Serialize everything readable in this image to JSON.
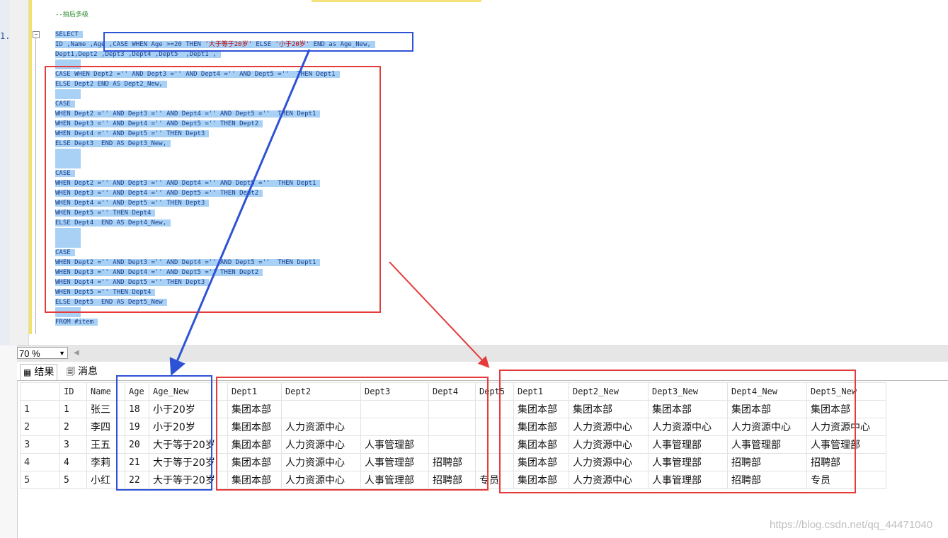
{
  "editor": {
    "line_number": "1.",
    "comment": "--拍后多级",
    "code_lines": [
      "SELECT",
      "ID ,Name ,Age ,CASE WHEN Age >=20 THEN '大于等于20岁' ELSE '小于20岁' END as Age_New,",
      "Dept1,Dept2 ,Dept3 ,Dept4 ,Dept5  ,Dept1 ,",
      "",
      "CASE WHEN Dept2 ='' AND Dept3 ='' AND Dept4 ='' AND Dept5 =''  THEN Dept1",
      "ELSE Dept2 END AS Dept2_New,",
      "",
      "CASE",
      "WHEN Dept2 ='' AND Dept3 ='' AND Dept4 ='' AND Dept5 =''  THEN Dept1",
      "WHEN Dept3 ='' AND Dept4 ='' AND Dept5 ='' THEN Dept2",
      "WHEN Dept4 ='' AND Dept5 ='' THEN Dept3",
      "ELSE Dept3  END AS Dept3_New,",
      "",
      "",
      "CASE",
      "WHEN Dept2 ='' AND Dept3 ='' AND Dept4 ='' AND Dept5 =''  THEN Dept1",
      "WHEN Dept3 ='' AND Dept4 ='' AND Dept5 ='' THEN Dept2",
      "WHEN Dept4 ='' AND Dept5 ='' THEN Dept3",
      "WHEN Dept5 ='' THEN Dept4",
      "ELSE Dept4  END AS Dept4_New,",
      "",
      "",
      "CASE",
      "WHEN Dept2 ='' AND Dept3 ='' AND Dept4 ='' AND Dept5 =''  THEN Dept1",
      "WHEN Dept3 ='' AND Dept4 ='' AND Dept5 ='' THEN Dept2",
      "WHEN Dept4 ='' AND Dept5 ='' THEN Dept3",
      "WHEN Dept5 ='' THEN Dept4",
      "ELSE Dept5  END AS Dept5_New",
      "",
      "FROM #item"
    ]
  },
  "zoom": {
    "value": "70 %"
  },
  "tabs": {
    "results": "结果",
    "messages": "消息"
  },
  "results": {
    "columns": [
      "ID",
      "Name",
      "Age",
      "Age_New",
      "Dept1",
      "Dept2",
      "Dept3",
      "Dept4",
      "Dept5",
      "Dept1",
      "Dept2_New",
      "Dept3_New",
      "Dept4_New",
      "Dept5_New"
    ],
    "rows": [
      {
        "n": "1",
        "cells": [
          "1",
          "张三",
          "18",
          "小于20岁",
          "集团本部",
          "",
          "",
          "",
          "",
          "集团本部",
          "集团本部",
          "集团本部",
          "集团本部",
          "集团本部"
        ]
      },
      {
        "n": "2",
        "cells": [
          "2",
          "李四",
          "19",
          "小于20岁",
          "集团本部",
          "人力资源中心",
          "",
          "",
          "",
          "集团本部",
          "人力资源中心",
          "人力资源中心",
          "人力资源中心",
          "人力资源中心"
        ]
      },
      {
        "n": "3",
        "cells": [
          "3",
          "王五",
          "20",
          "大于等于20岁",
          "集团本部",
          "人力资源中心",
          "人事管理部",
          "",
          "",
          "集团本部",
          "人力资源中心",
          "人事管理部",
          "人事管理部",
          "人事管理部"
        ]
      },
      {
        "n": "4",
        "cells": [
          "4",
          "李莉",
          "21",
          "大于等于20岁",
          "集团本部",
          "人力资源中心",
          "人事管理部",
          "招聘部",
          "",
          "集团本部",
          "人力资源中心",
          "人事管理部",
          "招聘部",
          "招聘部"
        ]
      },
      {
        "n": "5",
        "cells": [
          "5",
          "小红",
          "22",
          "大于等于20岁",
          "集团本部",
          "人力资源中心",
          "人事管理部",
          "招聘部",
          "专员",
          "集团本部",
          "人力资源中心",
          "人事管理部",
          "招聘部",
          "专员"
        ]
      }
    ]
  },
  "watermark": "https://blog.csdn.net/qq_44471040",
  "colors": {
    "annotation_blue": "#2e52d6",
    "annotation_red": "#e53b3b",
    "selection": "#a8d1f5"
  }
}
